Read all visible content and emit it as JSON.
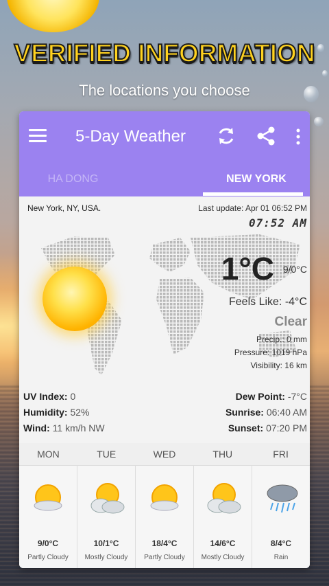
{
  "promo": {
    "headline": "VERIFIED INFORMATION",
    "subline": "The locations you choose"
  },
  "app": {
    "title": "5-Day Weather",
    "tabs": [
      {
        "label": "HA DONG",
        "selected": false
      },
      {
        "label": "NEW YORK",
        "selected": true
      }
    ],
    "accent_color": "#9b82f0"
  },
  "current": {
    "location": "New York, NY, USA.",
    "last_update": "Last update: Apr 01  06:52 PM",
    "clock": "07:52 AM",
    "temperature": "1°C",
    "min_max": "9/0°C",
    "feels_like": "Feels Like: -4°C",
    "condition": "Clear",
    "precip": "Precip.: 0 mm",
    "pressure": "Pressure: 1019 hPa",
    "visibility": "Visibility: 16 km",
    "uv_label": "UV Index:",
    "uv_value": "0",
    "humidity_label": "Humidity:",
    "humidity_value": "52%",
    "wind_label": "Wind:",
    "wind_value": "11 km/h NW",
    "dew_label": "Dew Point:",
    "dew_value": "-7°C",
    "sunrise_label": "Sunrise:",
    "sunrise_value": "06:40 AM",
    "sunset_label": "Sunset:",
    "sunset_value": "07:20 PM"
  },
  "forecast": [
    {
      "day": "MON",
      "temp": "9/0°C",
      "desc": "Partly Cloudy",
      "icon": "partly-cloudy-icon"
    },
    {
      "day": "TUE",
      "temp": "10/1°C",
      "desc": "Mostly Cloudy",
      "icon": "mostly-cloudy-icon"
    },
    {
      "day": "WED",
      "temp": "18/4°C",
      "desc": "Partly Cloudy",
      "icon": "partly-cloudy-icon"
    },
    {
      "day": "THU",
      "temp": "14/6°C",
      "desc": "Mostly Cloudy",
      "icon": "mostly-cloudy-icon"
    },
    {
      "day": "FRI",
      "temp": "8/4°C",
      "desc": "Rain",
      "icon": "rain-icon"
    }
  ]
}
